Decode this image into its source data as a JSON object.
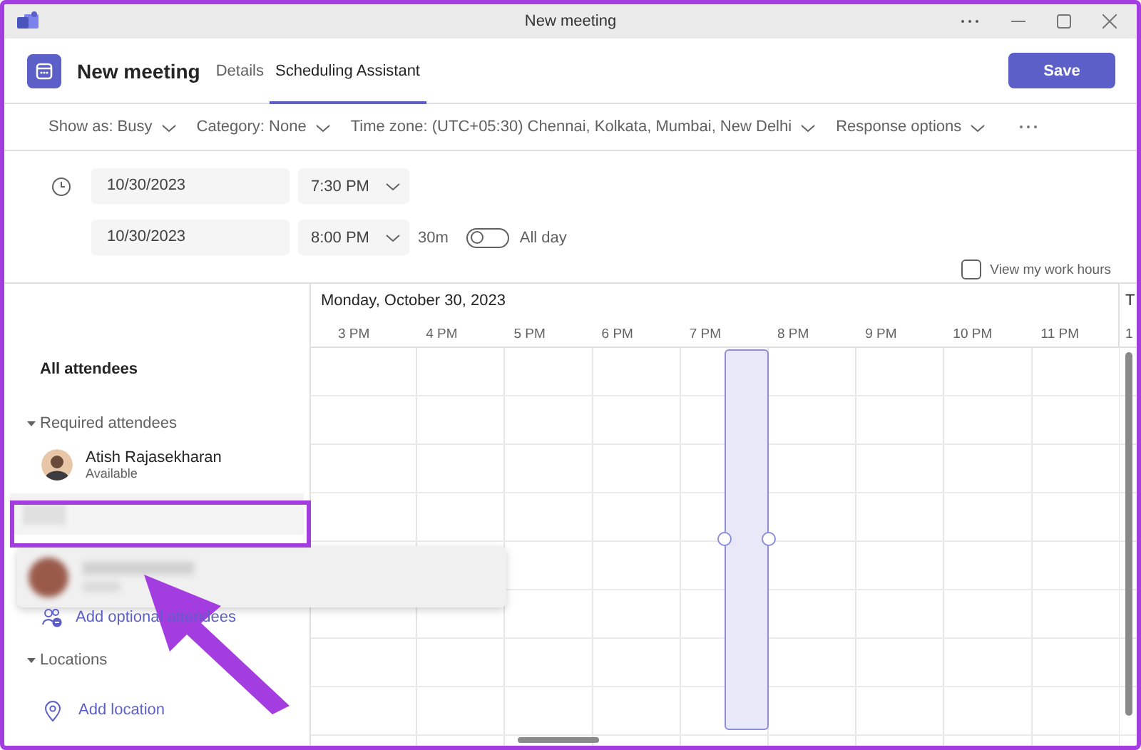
{
  "window": {
    "title": "New meeting"
  },
  "header": {
    "title": "New meeting",
    "tabs": [
      {
        "label": "Details",
        "selected": false
      },
      {
        "label": "Scheduling Assistant",
        "selected": true
      }
    ],
    "save": "Save"
  },
  "toolbar": [
    {
      "label": "Show as: Busy"
    },
    {
      "label": "Category: None"
    },
    {
      "label": "Time zone: (UTC+05:30) Chennai, Kolkata, Mumbai, New Delhi"
    },
    {
      "label": "Response options"
    }
  ],
  "time": {
    "start": {
      "date": "10/30/2023",
      "time": "7:30 PM"
    },
    "end": {
      "date": "10/30/2023",
      "time": "8:00 PM"
    },
    "duration": "30m",
    "all_day": {
      "label": "All day",
      "on": false
    }
  },
  "work_hours": {
    "label": "View my work hours",
    "checked": false
  },
  "grid": {
    "date": "Monday, October 30, 2023",
    "next_day": "T",
    "hours": [
      "3 PM",
      "4 PM",
      "5 PM",
      "6 PM",
      "7 PM",
      "8 PM",
      "9 PM",
      "10 PM",
      "11 PM"
    ],
    "next_hour": "1"
  },
  "sidebar": {
    "all_attendees": "All attendees",
    "required": {
      "label": "Required attendees",
      "expanded": true,
      "attendees": [
        {
          "name": "Atish Rajasekharan",
          "status": "Available"
        }
      ]
    },
    "add_optional": "Add optional attendees",
    "locations": {
      "label": "Locations",
      "expanded": true
    },
    "add_location": "Add location"
  }
}
